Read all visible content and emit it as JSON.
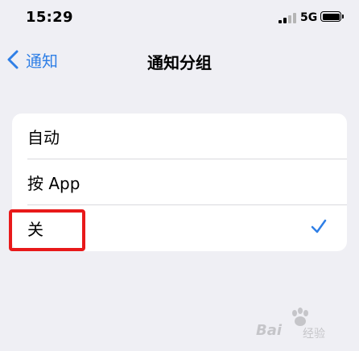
{
  "status_bar": {
    "time": "15:29",
    "network": "5G",
    "icons": [
      "signal-icon",
      "battery-icon"
    ]
  },
  "nav": {
    "back_label": "通知",
    "back_icon": "chevron-left-icon",
    "title": "通知分组",
    "accent_color": "#2f7fe6"
  },
  "grouping_options": [
    {
      "label": "自动",
      "selected": false
    },
    {
      "label": "按 App",
      "selected": false
    },
    {
      "label": "关",
      "selected": true
    }
  ],
  "highlight_color": "#e8191a",
  "watermark": {
    "text": "Bai",
    "sub": "经验",
    "icon": "paw-icon"
  }
}
